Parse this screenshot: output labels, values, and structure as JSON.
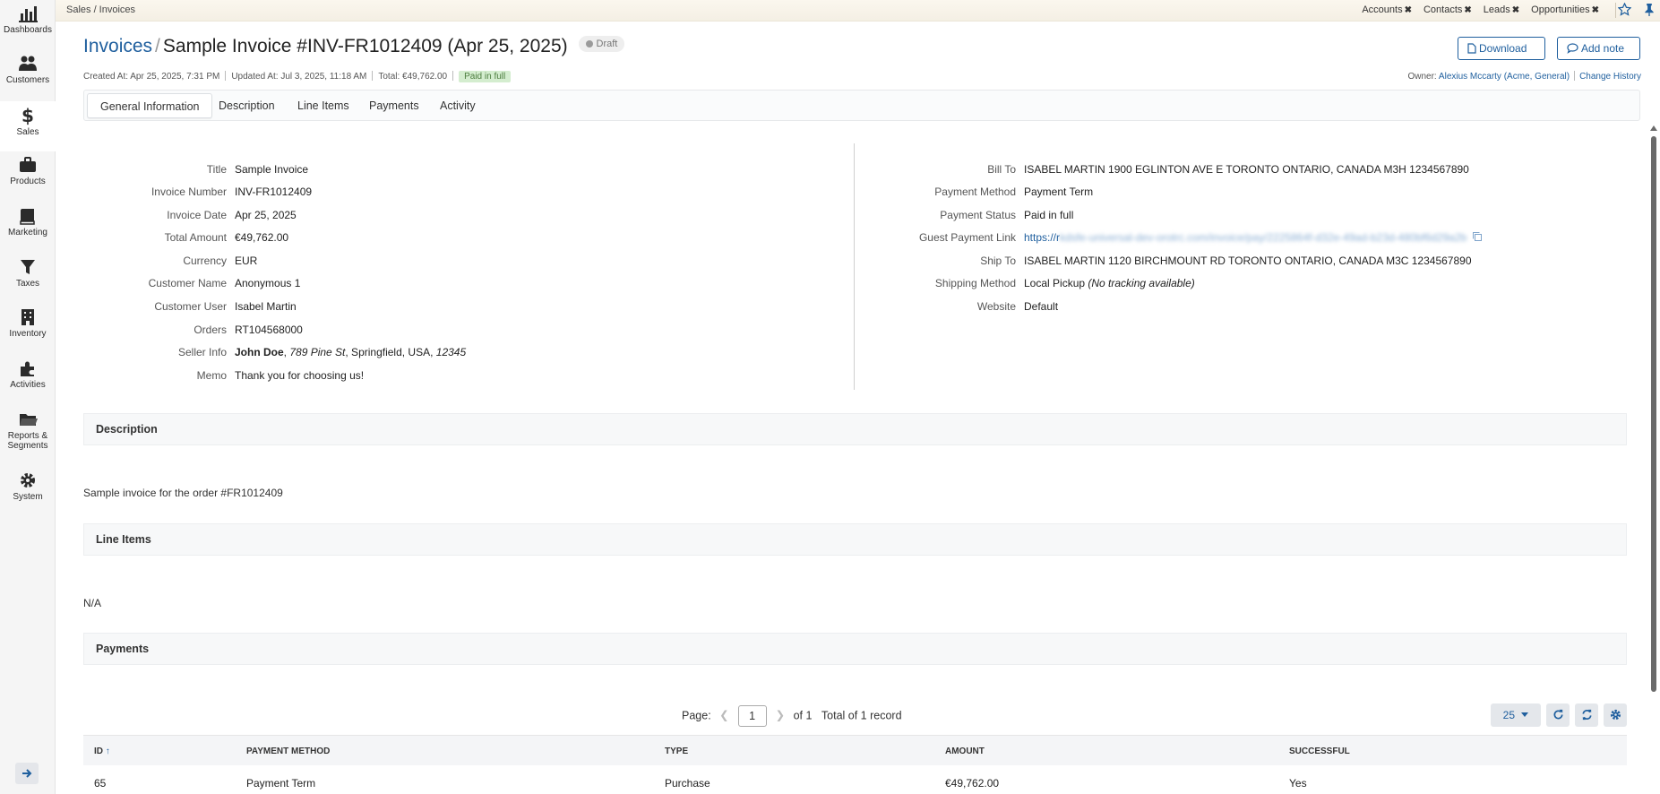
{
  "sidebar": {
    "items": [
      {
        "label": "Dashboards",
        "icon": "bar-chart-icon"
      },
      {
        "label": "Customers",
        "icon": "users-icon"
      },
      {
        "label": "Sales",
        "icon": "dollar-icon",
        "active": true
      },
      {
        "label": "Products",
        "icon": "briefcase-icon"
      },
      {
        "label": "Marketing",
        "icon": "book-icon"
      },
      {
        "label": "Taxes",
        "icon": "filter-icon"
      },
      {
        "label": "Inventory",
        "icon": "building-icon"
      },
      {
        "label": "Activities",
        "icon": "puzzle-icon"
      },
      {
        "label": "Reports &",
        "label2": "Segments",
        "icon": "folder-icon"
      },
      {
        "label": "System",
        "icon": "gear-icon"
      }
    ],
    "toggle_icon": "arrow-right-icon"
  },
  "topbar": {
    "breadcrumb": "Sales / Invoices",
    "shortcuts": [
      "Accounts",
      "Contacts",
      "Leads",
      "Opportunities"
    ],
    "close_glyph": "✖"
  },
  "header": {
    "breadcrumb_link": "Invoices",
    "slash": "/",
    "title": "Sample Invoice #INV-FR1012409 (Apr 25, 2025)",
    "status_badge": "Draft",
    "download_label": "Download",
    "add_note_label": "Add note",
    "created": "Created At: Apr 25, 2025, 7:31 PM",
    "updated": "Updated At: Jul 3, 2025, 11:18 AM",
    "total": "Total: €49,762.00",
    "paid_badge": "Paid in full",
    "owner_label": "Owner:",
    "owner_value": "Alexius Mccarty (Acme, General)",
    "change_history": "Change History"
  },
  "tabs": [
    "General Information",
    "Description",
    "Line Items",
    "Payments",
    "Activity"
  ],
  "left_fields": [
    {
      "label": "Title",
      "value": "Sample Invoice"
    },
    {
      "label": "Invoice Number",
      "value": "INV-FR1012409"
    },
    {
      "label": "Invoice Date",
      "value": "Apr 25, 2025"
    },
    {
      "label": "Total Amount",
      "value": "€49,762.00"
    },
    {
      "label": "Currency",
      "value": "EUR"
    },
    {
      "label": "Customer Name",
      "value": "Anonymous 1"
    },
    {
      "label": "Customer User",
      "value": "Isabel Martin"
    },
    {
      "label": "Orders",
      "value": "RT104568000"
    },
    {
      "label": "Seller Info",
      "value_bold": "John Doe",
      "value_rest1": ", ",
      "value_italic1": "789 Pine St",
      "value_rest2": ", Springfield, USA, ",
      "value_italic2": "12345"
    },
    {
      "label": "Memo",
      "value": "Thank you for choosing us!"
    }
  ],
  "right_fields": [
    {
      "label": "Bill To",
      "value": "ISABEL MARTIN 1900 EGLINTON AVE E TORONTO ONTARIO, CANADA M3H 1234567890"
    },
    {
      "label": "Payment Method",
      "value": "Payment Term"
    },
    {
      "label": "Payment Status",
      "value": "Paid in full"
    },
    {
      "label": "Guest Payment Link",
      "value": "https://r",
      "value_blurred": "kdsfe-universal-dev-orotrc.com/invoice/pay/2225864f-d32e-49ad-b23d-480bf6d29a2b"
    },
    {
      "label": "Ship To",
      "value": "ISABEL MARTIN 1120 BIRCHMOUNT RD TORONTO ONTARIO, CANADA M3C 1234567890"
    },
    {
      "label": "Shipping Method",
      "value": "Local Pickup ",
      "value_italic": "(No tracking available)"
    },
    {
      "label": "Website",
      "value": "Default"
    }
  ],
  "sections": {
    "description_title": "Description",
    "description_text": "Sample invoice for the order #FR1012409",
    "line_items_title": "Line Items",
    "line_items_text": "N/A",
    "payments_title": "Payments"
  },
  "pager": {
    "page_label": "Page:",
    "page": "1",
    "of": "of 1",
    "total": "Total of 1 record",
    "per_page": "25"
  },
  "payments_table": {
    "columns": [
      "ID",
      "PAYMENT METHOD",
      "TYPE",
      "AMOUNT",
      "SUCCESSFUL"
    ],
    "sort_glyph": "↑",
    "rows": [
      [
        "65",
        "Payment Term",
        "Purchase",
        "€49,762.00",
        "Yes"
      ]
    ]
  }
}
